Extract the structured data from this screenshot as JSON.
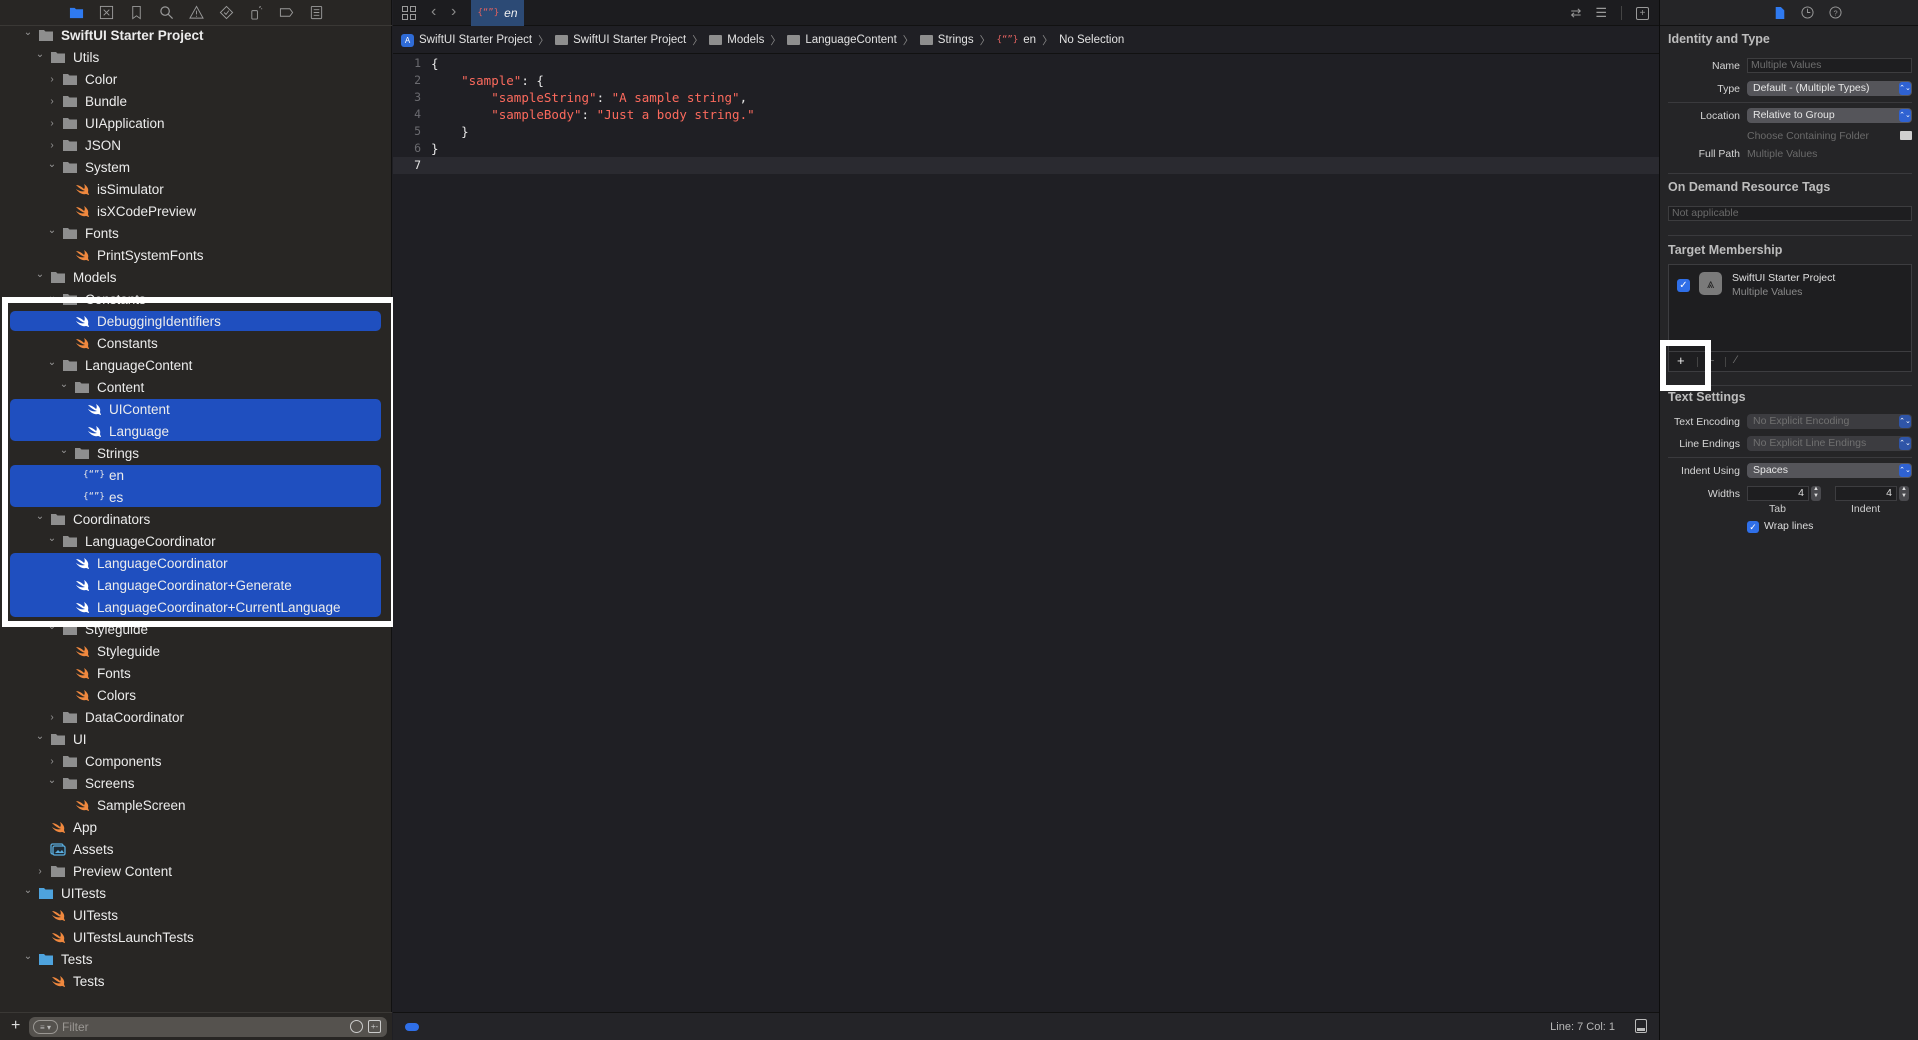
{
  "navigator": {
    "toolbar_icons": [
      "project-navigator-icon",
      "source-control-icon",
      "bookmark-icon",
      "find-icon",
      "issue-icon",
      "test-icon",
      "debug-icon",
      "breakpoint-icon",
      "report-icon"
    ],
    "tree": [
      {
        "label": "SwiftUI Starter Project",
        "type": "project-folder",
        "depth": 0,
        "expanded": true
      },
      {
        "label": "Utils",
        "type": "folder",
        "depth": 1,
        "expanded": true
      },
      {
        "label": "Color",
        "type": "folder",
        "depth": 2,
        "expanded": false
      },
      {
        "label": "Bundle",
        "type": "folder",
        "depth": 2,
        "expanded": false
      },
      {
        "label": "UIApplication",
        "type": "folder",
        "depth": 2,
        "expanded": false
      },
      {
        "label": "JSON",
        "type": "folder",
        "depth": 2,
        "expanded": false
      },
      {
        "label": "System",
        "type": "folder",
        "depth": 2,
        "expanded": true
      },
      {
        "label": "isSimulator",
        "type": "swift",
        "depth": 3
      },
      {
        "label": "isXCodePreview",
        "type": "swift",
        "depth": 3
      },
      {
        "label": "Fonts",
        "type": "folder",
        "depth": 2,
        "expanded": true
      },
      {
        "label": "PrintSystemFonts",
        "type": "swift",
        "depth": 3
      },
      {
        "label": "Models",
        "type": "folder",
        "depth": 1,
        "expanded": true
      },
      {
        "label": "Constants",
        "type": "folder",
        "depth": 2,
        "expanded": true
      },
      {
        "label": "DebuggingIdentifiers",
        "type": "swift",
        "depth": 3,
        "selected": true
      },
      {
        "label": "Constants",
        "type": "swift",
        "depth": 3
      },
      {
        "label": "LanguageContent",
        "type": "folder",
        "depth": 2,
        "expanded": true
      },
      {
        "label": "Content",
        "type": "folder",
        "depth": 3,
        "expanded": true
      },
      {
        "label": "UIContent",
        "type": "swift",
        "depth": 4,
        "selected": true
      },
      {
        "label": "Language",
        "type": "swift",
        "depth": 4,
        "selected": true
      },
      {
        "label": "Strings",
        "type": "folder",
        "depth": 3,
        "expanded": true
      },
      {
        "label": "en",
        "type": "json",
        "depth": 4,
        "selected": true
      },
      {
        "label": "es",
        "type": "json",
        "depth": 4,
        "selected": true
      },
      {
        "label": "Coordinators",
        "type": "folder",
        "depth": 1,
        "expanded": true
      },
      {
        "label": "LanguageCoordinator",
        "type": "folder",
        "depth": 2,
        "expanded": true
      },
      {
        "label": "LanguageCoordinator",
        "type": "swift",
        "depth": 3,
        "selected": true
      },
      {
        "label": "LanguageCoordinator+Generate",
        "type": "swift",
        "depth": 3,
        "selected": true
      },
      {
        "label": "LanguageCoordinator+CurrentLanguage",
        "type": "swift",
        "depth": 3,
        "selected": true
      },
      {
        "label": "Styleguide",
        "type": "folder",
        "depth": 2,
        "expanded": true
      },
      {
        "label": "Styleguide",
        "type": "swift",
        "depth": 3
      },
      {
        "label": "Fonts",
        "type": "swift",
        "depth": 3
      },
      {
        "label": "Colors",
        "type": "swift",
        "depth": 3
      },
      {
        "label": "DataCoordinator",
        "type": "folder",
        "depth": 2,
        "expanded": false
      },
      {
        "label": "UI",
        "type": "folder",
        "depth": 1,
        "expanded": true
      },
      {
        "label": "Components",
        "type": "folder",
        "depth": 2,
        "expanded": false
      },
      {
        "label": "Screens",
        "type": "folder",
        "depth": 2,
        "expanded": true
      },
      {
        "label": "SampleScreen",
        "type": "swift",
        "depth": 3
      },
      {
        "label": "App",
        "type": "swift",
        "depth": 1
      },
      {
        "label": "Assets",
        "type": "assets",
        "depth": 1
      },
      {
        "label": "Preview Content",
        "type": "folder",
        "depth": 1,
        "expanded": false
      },
      {
        "label": "UITests",
        "type": "target-folder",
        "depth": 0,
        "expanded": true
      },
      {
        "label": "UITests",
        "type": "swift",
        "depth": 1
      },
      {
        "label": "UITestsLaunchTests",
        "type": "swift",
        "depth": 1
      },
      {
        "label": "Tests",
        "type": "target-folder",
        "depth": 0,
        "expanded": true
      },
      {
        "label": "Tests",
        "type": "swift",
        "depth": 1
      }
    ],
    "filter": {
      "placeholder": "Filter",
      "value": ""
    }
  },
  "editor": {
    "tab": {
      "label": "en"
    },
    "breadcrumb": [
      {
        "label": "SwiftUI Starter Project",
        "icon": "app-icon"
      },
      {
        "label": "SwiftUI Starter Project",
        "icon": "folder-icon"
      },
      {
        "label": "Models",
        "icon": "folder-icon"
      },
      {
        "label": "LanguageContent",
        "icon": "folder-icon"
      },
      {
        "label": "Strings",
        "icon": "folder-icon"
      },
      {
        "label": "en",
        "icon": "json-icon"
      },
      {
        "label": "No Selection",
        "icon": ""
      }
    ],
    "code_lines": [
      [
        {
          "t": "{",
          "c": "p"
        }
      ],
      [
        {
          "t": "    ",
          "c": "p"
        },
        {
          "t": "\"sample\"",
          "c": "s"
        },
        {
          "t": ": {",
          "c": "p"
        }
      ],
      [
        {
          "t": "        ",
          "c": "p"
        },
        {
          "t": "\"sampleString\"",
          "c": "s"
        },
        {
          "t": ": ",
          "c": "p"
        },
        {
          "t": "\"A sample string\"",
          "c": "s"
        },
        {
          "t": ",",
          "c": "p"
        }
      ],
      [
        {
          "t": "        ",
          "c": "p"
        },
        {
          "t": "\"sampleBody\"",
          "c": "s"
        },
        {
          "t": ": ",
          "c": "p"
        },
        {
          "t": "\"Just a body string.\"",
          "c": "s"
        }
      ],
      [
        {
          "t": "    }",
          "c": "p"
        }
      ],
      [
        {
          "t": "}",
          "c": "p"
        }
      ],
      [
        {
          "t": "",
          "c": "p"
        }
      ]
    ],
    "current_line": 7,
    "status": {
      "cursor": "Line: 7  Col: 1"
    }
  },
  "inspector": {
    "identity": {
      "title": "Identity and Type",
      "name_label": "Name",
      "name_placeholder": "Multiple Values",
      "type_label": "Type",
      "type_value": "Default - (Multiple Types)",
      "location_label": "Location",
      "location_value": "Relative to Group",
      "choose_folder": "Choose Containing Folder",
      "full_path_label": "Full Path",
      "full_path_value": "Multiple Values"
    },
    "odr": {
      "title": "On Demand Resource Tags",
      "placeholder": "Not applicable"
    },
    "target_membership": {
      "title": "Target Membership",
      "target_name": "SwiftUI Starter Project",
      "target_sub": "Multiple Values",
      "checked": true,
      "add_label": "+",
      "remove_label": "−",
      "edit_label": "⁄"
    },
    "text_settings": {
      "title": "Text Settings",
      "encoding_label": "Text Encoding",
      "encoding_value": "No Explicit Encoding",
      "line_endings_label": "Line Endings",
      "line_endings_value": "No Explicit Line Endings",
      "indent_using_label": "Indent Using",
      "indent_using_value": "Spaces",
      "widths_label": "Widths",
      "tab_value": "4",
      "indent_value": "4",
      "tab_caption": "Tab",
      "indent_caption": "Indent",
      "wrap_label": "Wrap lines",
      "wrap_checked": true
    }
  }
}
